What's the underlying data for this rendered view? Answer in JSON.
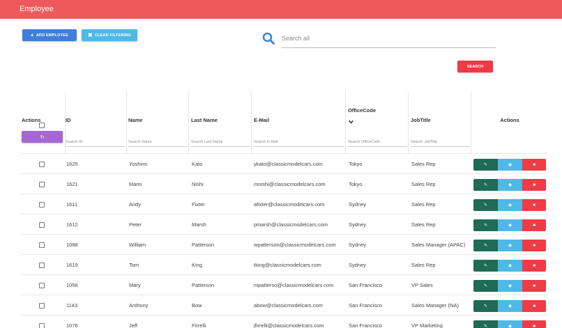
{
  "header": {
    "title": "Employee"
  },
  "toolbar": {
    "add_label": "ADD EMPLOYEE",
    "clear_label": "CLEAR FILTERING",
    "search_placeholder": "Search all",
    "search_button": "SEARCH"
  },
  "table": {
    "columns": [
      {
        "key": "actions_left",
        "label": "Actions"
      },
      {
        "key": "id",
        "label": "ID"
      },
      {
        "key": "name",
        "label": "Name"
      },
      {
        "key": "last_name",
        "label": "Last Name"
      },
      {
        "key": "email",
        "label": "E-Mail"
      },
      {
        "key": "office",
        "label": "OfficeCode"
      },
      {
        "key": "job",
        "label": "JobTitle"
      },
      {
        "key": "actions_right",
        "label": "Actions"
      }
    ],
    "filter_placeholders": {
      "id": "Search ID",
      "name": "Search Name",
      "last_name": "Search Last Name",
      "email": "Search E-Mail",
      "office": "Search OfficeCode",
      "job": "Search JobTitle"
    },
    "rows": [
      {
        "id": "1625",
        "name": "Yoshimi",
        "last_name": "Kato",
        "email": "ykato@classicmodelcars.com",
        "office": "Tokyo",
        "job": "Sales Rep"
      },
      {
        "id": "1621",
        "name": "Mami",
        "last_name": "Nishi",
        "email": "mnishi@classicmodelcars.com",
        "office": "Tokyo",
        "job": "Sales Rep"
      },
      {
        "id": "1611",
        "name": "Andy",
        "last_name": "Fixter",
        "email": "afixter@classicmodelcars.com",
        "office": "Sydney",
        "job": "Sales Rep"
      },
      {
        "id": "1612",
        "name": "Peter",
        "last_name": "Marsh",
        "email": "pmarsh@classicmodelcars.com",
        "office": "Sydney",
        "job": "Sales Rep"
      },
      {
        "id": "1088",
        "name": "William",
        "last_name": "Patterson",
        "email": "wpatterson@classicmodelcars.com",
        "office": "Sydney",
        "job": "Sales Manager (APAC)"
      },
      {
        "id": "1619",
        "name": "Tom",
        "last_name": "King",
        "email": "tking@classicmodelcars.com",
        "office": "Sydney",
        "job": "Sales Rep"
      },
      {
        "id": "1056",
        "name": "Mary",
        "last_name": "Patterson",
        "email": "mpatterso@classicmodelcars.com",
        "office": "San Francisco",
        "job": "VP Sales"
      },
      {
        "id": "1143",
        "name": "Anthony",
        "last_name": "Bow",
        "email": "abow@classicmodelcars.com",
        "office": "San Francisco",
        "job": "Sales Manager (NA)"
      },
      {
        "id": "1076",
        "name": "Jeff",
        "last_name": "Firrelli",
        "email": "jfirrelli@classicmodelcars.com",
        "office": "San Francisco",
        "job": "VP Marketing"
      }
    ]
  },
  "colors": {
    "header": "#ee5a5c",
    "add": "#3f7fd9",
    "clear": "#4fb8e6",
    "search": "#ee3b45",
    "edit": "#1f6b55",
    "view": "#4fb8e6",
    "delete": "#ee3b45",
    "refresh": "#a667d6"
  },
  "icons": {
    "add": "plus-icon",
    "clear": "clear-filter-icon",
    "search": "search-icon",
    "sort": "chevron-down-icon",
    "refresh": "refresh-icon",
    "edit": "pencil-icon",
    "view": "eye-icon",
    "delete": "trash-icon"
  }
}
